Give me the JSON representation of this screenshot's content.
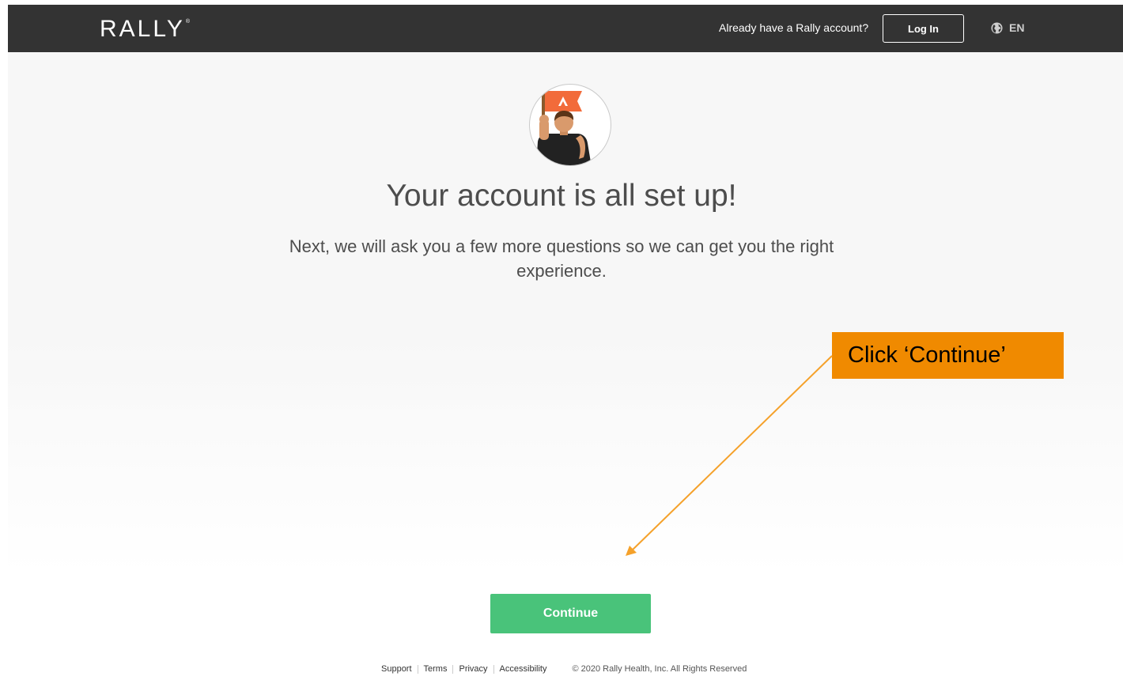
{
  "header": {
    "logo_text": "RALLY",
    "logo_mark": "®",
    "account_prompt": "Already have a Rally account?",
    "login_label": "Log In",
    "language": "EN"
  },
  "main": {
    "headline": "Your account is all set up!",
    "subtext": "Next, we will ask you a few more questions so we can get you the right experience.",
    "continue_label": "Continue"
  },
  "annotation": {
    "callout_text": "Click ‘Continue’"
  },
  "footer": {
    "links": [
      "Support",
      "Terms",
      "Privacy",
      "Accessibility"
    ],
    "copyright": "© 2020 Rally Health, Inc. All Rights Reserved"
  },
  "colors": {
    "topbar": "#333333",
    "accent_orange": "#f08a00",
    "continue_green": "#49c37a",
    "flag_orange": "#f26b3a"
  },
  "icons": [
    "globe-icon",
    "flag-person-illustration"
  ]
}
